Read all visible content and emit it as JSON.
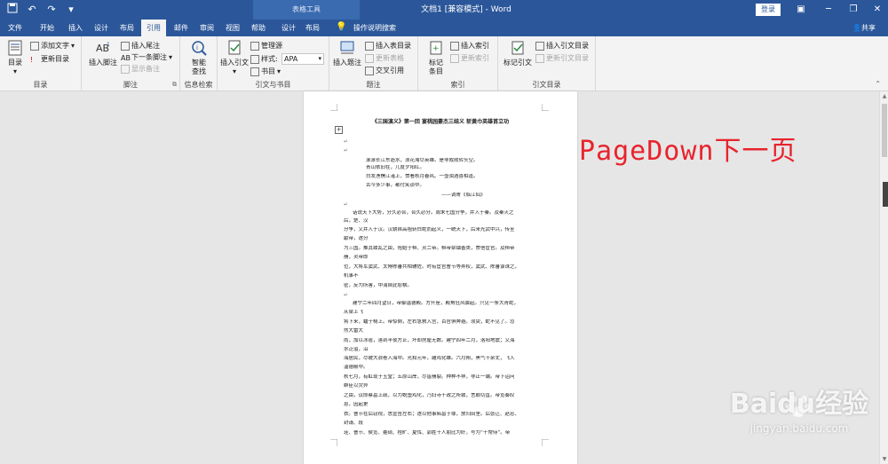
{
  "titlebar": {
    "context_tools": "表格工具",
    "doc_title": "文档1 [兼容模式] - Word",
    "login": "登录"
  },
  "tabs": [
    "文件",
    "开始",
    "插入",
    "设计",
    "布局",
    "引用",
    "邮件",
    "审阅",
    "视图",
    "帮助",
    "设计",
    "布局"
  ],
  "active_tab": "引用",
  "tell_me": "操作说明搜索",
  "share": "共享",
  "ribbon": {
    "toc": {
      "big": "目录",
      "add_text": "添加文字",
      "update_toc": "更新目录",
      "label": "目录"
    },
    "footnotes": {
      "insert_footnote": "插入脚注",
      "insert_endnote": "插入尾注",
      "next_footnote": "下一条脚注",
      "show_notes": "显示备注",
      "label": "脚注"
    },
    "research": {
      "smart_lookup_1": "智能",
      "smart_lookup_2": "查找",
      "label": "信息检索"
    },
    "citations": {
      "insert_citation": "插入引文",
      "manage_sources": "管理源",
      "style_label": "样式:",
      "style_value": "APA",
      "bibliography": "书目",
      "label": "引文与书目"
    },
    "captions": {
      "insert_caption": "插入题注",
      "insert_table_of_figures": "插入表目录",
      "update_table": "更新表格",
      "cross_reference": "交叉引用",
      "label": "题注"
    },
    "index": {
      "mark_entry_1": "标记",
      "mark_entry_2": "条目",
      "insert_index": "插入索引",
      "update_index": "更新索引",
      "label": "索引"
    },
    "toa": {
      "mark_citation": "标记引文",
      "insert_toa": "插入引文目录",
      "update_toa": "更新引文目录",
      "label": "引文目录"
    }
  },
  "document": {
    "heading": "《三国演义》第一回 宴桃园豪杰三结义 斩黄巾英雄首立功",
    "lines": [
      "滚滚长江东逝水，浪花淘尽英雄。是非成败转头空。",
      "青山依旧在，几度夕阳红。",
      "白发渔樵江渚上，惯看秋月春风。一壶浊酒喜相逢。",
      "古今多少事，都付笑谈中。",
      "——调寄《临江仙》",
      "话说天下大势，分久必合，合久必分。周末七国分争，并入于秦。及秦灭之",
      "后，楚、汉",
      "分争，又并入于汉。汉朝自高祖斩白蛇而起义，一统天下，后来光武中兴，传至",
      "献帝，遂分",
      "为三国。推其致乱之由，殆始于桓、灵二帝。桓帝禁锢善类，崇信宦官。及桓帝",
      "崩，灵帝即",
      "位，大将军窦武、太傅陈蕃共相辅佐。时有宦官曹节等弄权，窦武、陈蕃谋诛之，",
      "机事不",
      "密，反为所害，中涓自此愈横。",
      "建宁二年四月望日，帝御温德殿。方升座，殿角狂风骤起。只见一条大青蛇，",
      "从梁上飞",
      "将下来，蟠于椅上。帝惊倒，左右急救入宫，百官俱奔避。须臾，蛇不见了。忽",
      "然大雷大",
      "雨，加以冰雹，落到半夜方止，坏却房屋无数。建宁四年二月，洛阳地震；又海",
      "水泛溢，沿",
      "海居民，尽被大浪卷入海中。光和元年，雌鸡化雄。六月朔，黑气十余丈，飞入",
      "温德殿中。",
      "秋七月，有虹现于玉堂；五原山岸，尽皆崩裂。种种不祥，非止一端。帝下诏问",
      "群臣以灾异",
      "之由，议郎蔡邕上疏，以为蜺堕鸡化，乃妇寺干政之所致，言颇切直。帝览奏叹",
      "息，因起更",
      "衣。曹节在后窃视，悉宣告左右；遂以他事陷邕于罪，放归田里。后张让、赵忠、",
      "封谞、段",
      "珪、曹节、侯览、蹇硕、程旷、夏恽、郭胜十人朋比为奸，号为“十常侍”。帝"
    ]
  },
  "overlay": "PageDown下一页",
  "watermark": {
    "brand": "Baidu经验",
    "url": "jingyan.baidu.com"
  }
}
